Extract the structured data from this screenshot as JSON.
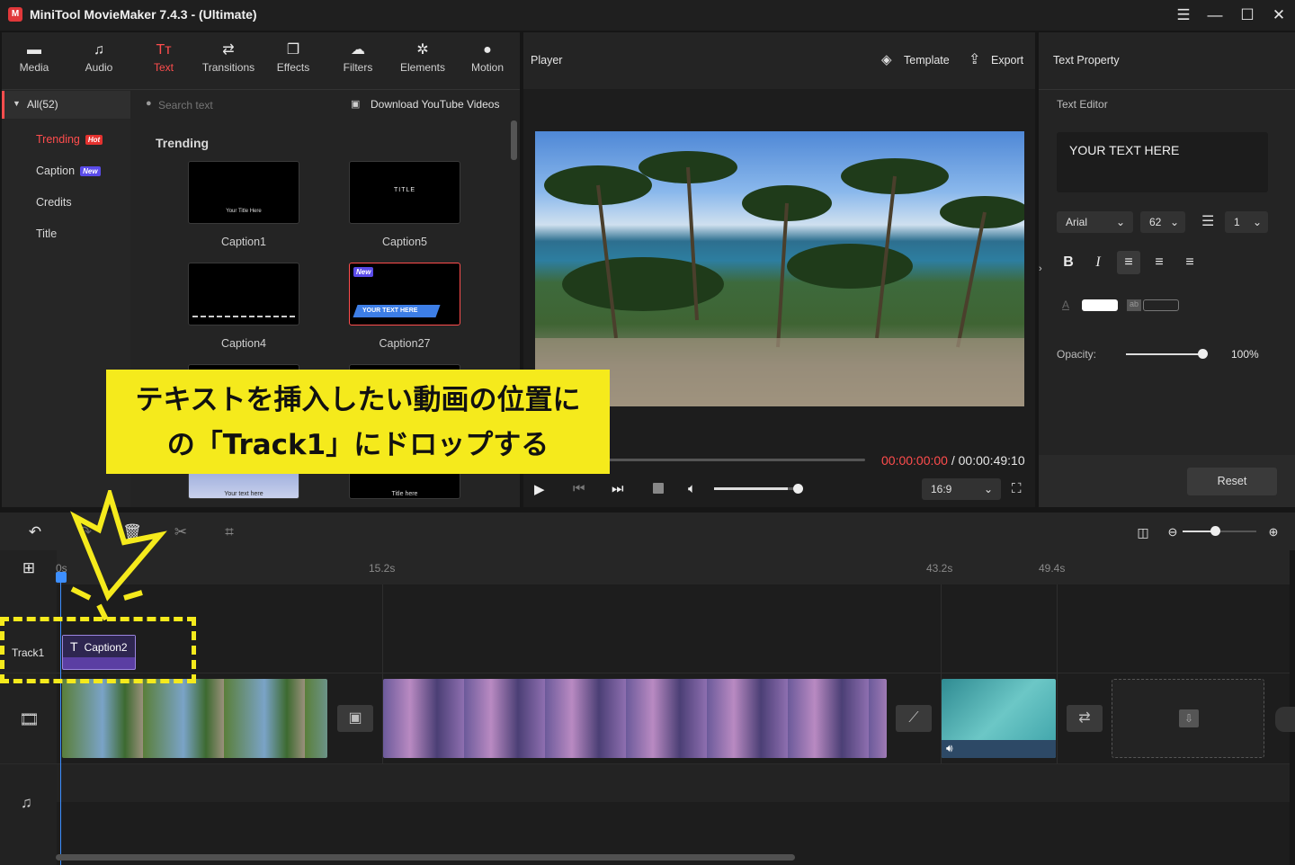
{
  "app": {
    "logo": "M",
    "title": "MiniTool MovieMaker 7.4.3 - (Ultimate)"
  },
  "window_controls": {
    "menu": "☰",
    "minimize": "—",
    "maximize": "☐",
    "close": "✕"
  },
  "toolbar_tabs": [
    {
      "label": "Media",
      "icon": "▬"
    },
    {
      "label": "Audio",
      "icon": "♫"
    },
    {
      "label": "Text",
      "icon": "Tт"
    },
    {
      "label": "Transitions",
      "icon": "⇄"
    },
    {
      "label": "Effects",
      "icon": "❐"
    },
    {
      "label": "Filters",
      "icon": "☁"
    },
    {
      "label": "Elements",
      "icon": "✲"
    },
    {
      "label": "Motion",
      "icon": "●"
    }
  ],
  "library": {
    "all_label": "All(52)",
    "search_placeholder": "Search text",
    "download_label": "Download YouTube Videos",
    "categories": [
      {
        "label": "Trending",
        "badge": "Hot"
      },
      {
        "label": "Caption",
        "badge": "New"
      },
      {
        "label": "Credits",
        "badge": ""
      },
      {
        "label": "Title",
        "badge": ""
      }
    ],
    "section_title": "Trending",
    "items": [
      {
        "label": "Caption1",
        "preview_text": "Your  Title Here"
      },
      {
        "label": "Caption5",
        "preview_text": "TITLE"
      },
      {
        "label": "Caption4",
        "preview_text": ""
      },
      {
        "label": "Caption27",
        "preview_text": "YOUR TEXT HERE",
        "badge": "New"
      }
    ],
    "partial_items": [
      "Your text here",
      "Title here"
    ]
  },
  "player": {
    "label": "Player",
    "template_label": "Template",
    "export_label": "Export",
    "time_current": "00:00:00:00",
    "time_sep": " / ",
    "time_total": "00:00:49:10",
    "aspect": "16:9",
    "volume_level": 0.85
  },
  "text_property": {
    "header": "Text Property",
    "editor_label": "Text Editor",
    "text_value": "YOUR TEXT HERE",
    "font": "Arial",
    "size": "62",
    "line_spacing": "1",
    "opacity_label": "Opacity:",
    "opacity_value": "100%",
    "reset_label": "Reset"
  },
  "timeline": {
    "ruler": [
      "0s",
      "15.2s",
      "43.2s",
      "49.4s"
    ],
    "track_label": "Track1",
    "caption_clip": "Caption2",
    "caption_clip_icon": "T",
    "zoom_level": 0.45
  },
  "callout": {
    "line1": "テキストを挿入したい動画の位置に",
    "line2": "の「Track1」にドロップする"
  },
  "colors": {
    "accent": "#ff4d4d",
    "callout": "#f5ea1c",
    "caption_clip": "#5b3ea3"
  }
}
